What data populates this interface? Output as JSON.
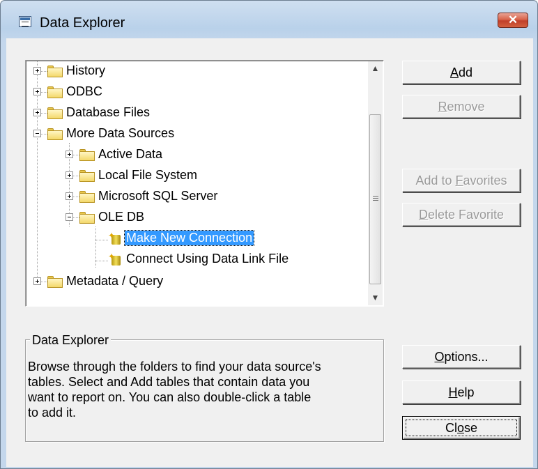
{
  "window": {
    "title": "Data Explorer",
    "close_glyph": "✕"
  },
  "tree": {
    "nodes": [
      {
        "label": "History"
      },
      {
        "label": "ODBC"
      },
      {
        "label": "Database Files"
      },
      {
        "label": "More Data Sources"
      },
      {
        "label": "Active Data"
      },
      {
        "label": "Local File System"
      },
      {
        "label": "Microsoft SQL Server"
      },
      {
        "label": "OLE DB"
      },
      {
        "label": "Make New Connection"
      },
      {
        "label": "Connect Using Data Link File"
      },
      {
        "label": "Metadata / Query"
      }
    ],
    "scroll_up_glyph": "▲",
    "scroll_down_glyph": "▼"
  },
  "buttons": {
    "add": {
      "pre": "",
      "u": "A",
      "post": "dd"
    },
    "remove": {
      "pre": "",
      "u": "R",
      "post": "emove"
    },
    "add_to_favorites": {
      "pre": "Add to ",
      "u": "F",
      "post": "avorites"
    },
    "delete_favorite": {
      "pre": "",
      "u": "D",
      "post": "elete Favorite"
    },
    "options": {
      "pre": "",
      "u": "O",
      "post": "ptions..."
    },
    "help": {
      "pre": "",
      "u": "H",
      "post": "elp"
    },
    "close": {
      "pre": "Cl",
      "u": "o",
      "post": "se"
    }
  },
  "info": {
    "title": "Data Explorer",
    "lines": [
      "Browse through the folders to find your data source's",
      "tables.  Select and Add tables that contain data you",
      "want to report on.  You can also double-click a table",
      "to add it."
    ]
  },
  "colors": {
    "selection": "#3399ff",
    "title_close": "#c7452c"
  }
}
